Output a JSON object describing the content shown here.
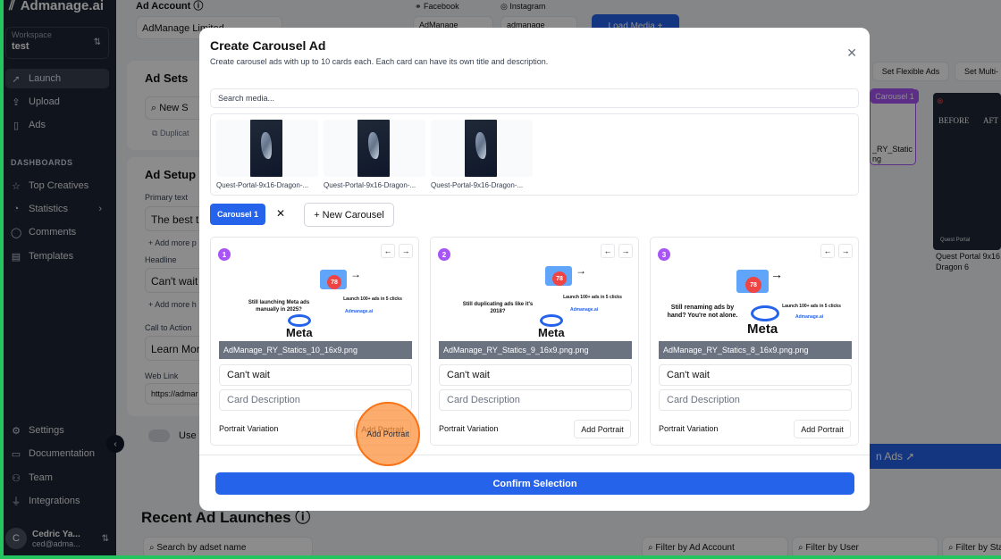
{
  "brand": "Admanage.ai",
  "workspace": {
    "label": "Workspace",
    "value": "test"
  },
  "nav": [
    {
      "label": "Launch",
      "icon": "rocket-icon"
    },
    {
      "label": "Upload",
      "icon": "upload-icon"
    },
    {
      "label": "Ads",
      "icon": "ads-icon"
    }
  ],
  "dashboards_label": "DASHBOARDS",
  "dash_nav": [
    {
      "label": "Top Creatives"
    },
    {
      "label": "Statistics"
    },
    {
      "label": "Comments"
    },
    {
      "label": "Templates"
    }
  ],
  "bottom_nav": [
    {
      "label": "Settings"
    },
    {
      "label": "Documentation"
    },
    {
      "label": "Team"
    },
    {
      "label": "Integrations"
    }
  ],
  "user": {
    "initial": "C",
    "name": "Cedric Ya...",
    "email": "ced@adma..."
  },
  "page": {
    "ad_account_label": "Ad Account",
    "ad_account_value": "AdManage Limited",
    "facebook": "Facebook",
    "instagram": "Instagram",
    "fb_account": "AdManage",
    "ig_account": "admanage",
    "load_media": "Load Media",
    "ad_sets": "Ad Sets",
    "new_s": "New S",
    "duplicat": "Duplicat",
    "ad_setup": "Ad Setup",
    "primary_text": "Primary text",
    "primary_value": "The best t",
    "add_more_p": "+ Add more p",
    "headline": "Headline",
    "headline_value": "Can't wait",
    "add_more_h": "+ Add more h",
    "cta": "Call to Action",
    "cta_value": "Learn Mor",
    "web_link": "Web Link",
    "web_link_value": "https://admar",
    "use": "Use I",
    "set_flexible": "Set Flexible Ads",
    "set_multi": "Set Multi-",
    "carousel_tag": "Carousel 1",
    "bg_name1": "_RY_Static",
    "bg_name1b": "ng",
    "before": "BEFORE",
    "after": "AFT",
    "quest_portal": "Quest Portal",
    "bg_name2": "Quest Portal 9x16",
    "bg_name2b": "Dragon 6",
    "launch_ads": "n Ads",
    "recent": "Recent Ad Launches",
    "search_adset": "Search by adset name",
    "filter_account": "Filter by Ad Account",
    "filter_user": "Filter by User",
    "filter_sta": "Filter by Sta"
  },
  "modal": {
    "title": "Create Carousel Ad",
    "subtitle": "Create carousel ads with up to 10 cards each. Each card can have its own title and description.",
    "search_placeholder": "Search media...",
    "media": [
      {
        "name": "Quest-Portal-9x16-Dragon-..."
      },
      {
        "name": "Quest-Portal-9x16-Dragon-..."
      },
      {
        "name": "Quest-Portal-9x16-Dragon-..."
      }
    ],
    "carousel_pill": "Carousel 1",
    "remove": "✕",
    "new_carousel": "+ New Carousel",
    "cards": [
      {
        "num": "1",
        "file": "AdManage_RY_Statics_10_16x9.png",
        "headline": "Still launching Meta ads manually in 2025?",
        "title": "Can't wait",
        "desc_placeholder": "Card Description",
        "portrait_label": "Portrait Variation",
        "add_portrait": "Add Portrait"
      },
      {
        "num": "2",
        "file": "AdManage_RY_Statics_9_16x9.png.png",
        "headline": "Still duplicating ads like it's 2018?",
        "title": "Can't wait",
        "desc_placeholder": "Card Description",
        "portrait_label": "Portrait Variation",
        "add_portrait": "Add Portrait"
      },
      {
        "num": "3",
        "file": "AdManage_RY_Statics_8_16x9.png.png",
        "headline": "Still renaming ads by hand? You're not alone.",
        "title": "Can't wait",
        "desc_placeholder": "Card Description",
        "portrait_label": "Portrait Variation",
        "add_portrait": "Add Portrait"
      }
    ],
    "art_sub": "Launch 100+ ads in 5 clicks",
    "art_brand": "Admanage.ai",
    "badge": "78",
    "meta": "Meta",
    "confirm": "Confirm Selection"
  }
}
